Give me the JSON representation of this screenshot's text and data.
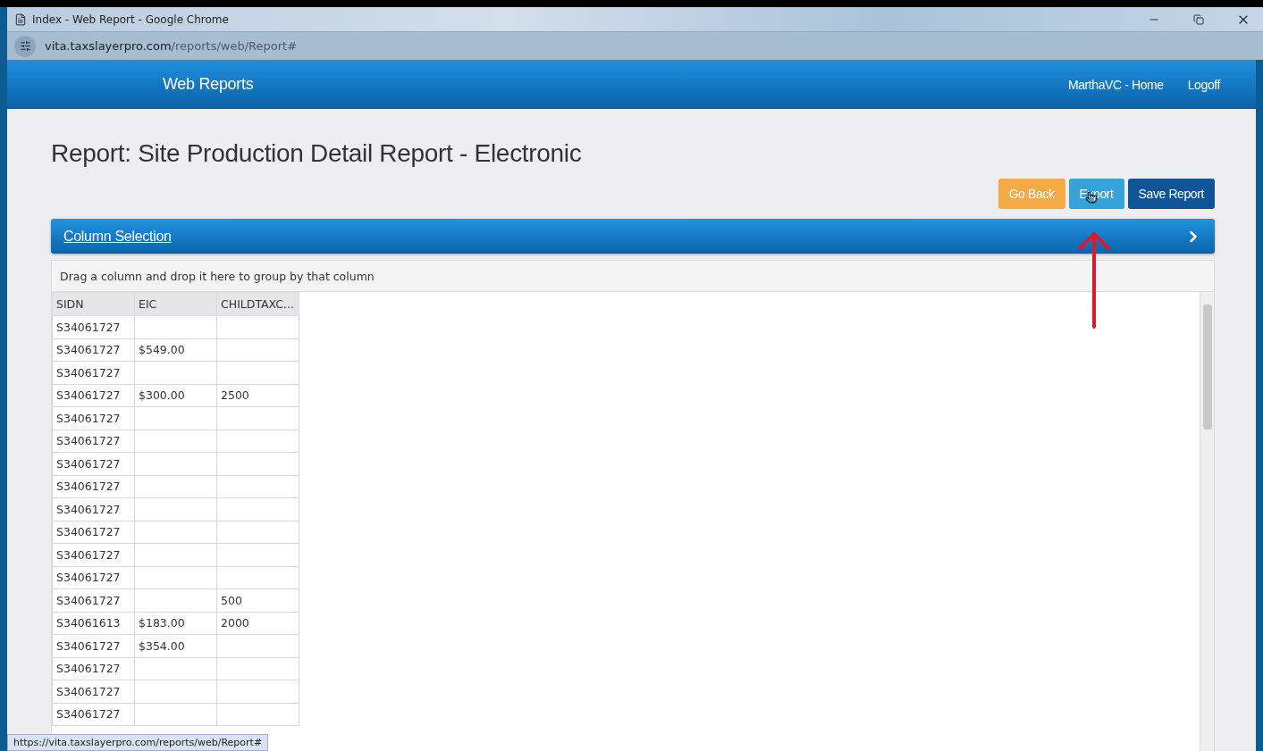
{
  "window": {
    "title": "Index - Web Report - Google Chrome"
  },
  "address_bar": {
    "host": "vita.taxslayerpro.com",
    "path": "/reports/web/Report#"
  },
  "header": {
    "brand": "Web Reports",
    "links": [
      "MarthaVC - Home",
      "Logoff"
    ]
  },
  "page_title": "Report: Site Production Detail Report - Electronic",
  "buttons": [
    {
      "label": "Go Back",
      "kind": "warning"
    },
    {
      "label": "Export",
      "kind": "info"
    },
    {
      "label": "Save Report",
      "kind": "primary"
    }
  ],
  "column_selection": {
    "label": "Column Selection",
    "expanded": false
  },
  "grid": {
    "group_hint": "Drag a column and drop it here to group by that column",
    "columns": [
      "SIDN",
      "EIC",
      "CHILDTAXC..."
    ],
    "rows": [
      [
        "S34061727",
        "",
        ""
      ],
      [
        "S34061727",
        "$549.00",
        ""
      ],
      [
        "S34061727",
        "",
        ""
      ],
      [
        "S34061727",
        "$300.00",
        "2500"
      ],
      [
        "S34061727",
        "",
        ""
      ],
      [
        "S34061727",
        "",
        ""
      ],
      [
        "S34061727",
        "",
        ""
      ],
      [
        "S34061727",
        "",
        ""
      ],
      [
        "S34061727",
        "",
        ""
      ],
      [
        "S34061727",
        "",
        ""
      ],
      [
        "S34061727",
        "",
        ""
      ],
      [
        "S34061727",
        "",
        ""
      ],
      [
        "S34061727",
        "",
        "500"
      ],
      [
        "S34061613",
        "$183.00",
        "2000"
      ],
      [
        "S34061727",
        "$354.00",
        ""
      ],
      [
        "S34061727",
        "",
        ""
      ],
      [
        "S34061727",
        "",
        ""
      ],
      [
        "S34061727",
        "",
        ""
      ]
    ]
  },
  "status_bar": {
    "url": "https://vita.taxslayerpro.com/reports/web/Report#"
  }
}
